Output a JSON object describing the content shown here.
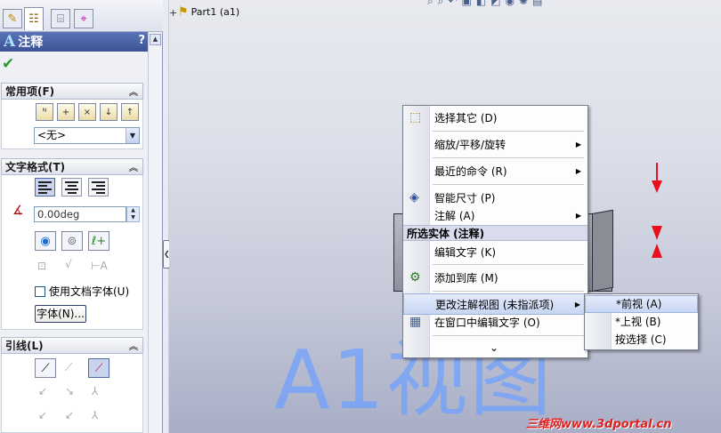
{
  "property_manager": {
    "title": "注释",
    "help": "?",
    "ok": "✔",
    "sections": {
      "common": {
        "label": "常用项(F)",
        "dropdown_value": "<无>"
      },
      "text_format": {
        "label": "文字格式(T)",
        "angle_value": "0.00deg",
        "use_doc_font_label": "使用文档字体(U)",
        "use_doc_font_checked": false,
        "font_button_label": "字体(N)..."
      },
      "leader": {
        "label": "引线(L)"
      }
    },
    "tabs": [
      "feature-manager",
      "property-manager",
      "configuration-manager",
      "dimxpert-manager"
    ]
  },
  "feature_tree": {
    "expand": "+",
    "part_label": "Part1 (a1)"
  },
  "graphics": {
    "big_text": "A1视图",
    "watermark": "三维网www.3dportal.cn"
  },
  "context_menu": {
    "items": [
      {
        "label": "选择其它 (D)",
        "submenu": false
      },
      {
        "label": "缩放/平移/旋转",
        "submenu": true
      },
      {
        "label": "最近的命令 (R)",
        "submenu": true
      },
      {
        "label": "智能尺寸 (P)",
        "submenu": false
      },
      {
        "label": "注解 (A)",
        "submenu": true
      }
    ],
    "section_header": "所选实体 (注释)",
    "section_items": [
      {
        "label": "编辑文字 (K)"
      },
      {
        "label": "添加到库 (M)"
      },
      {
        "label": "更改注解视图 (未指派项)",
        "submenu": true
      },
      {
        "label": "在窗口中编辑文字 (O)"
      }
    ],
    "more": "⌄"
  },
  "submenu": {
    "items": [
      "*前视 (A)",
      "*上视 (B)",
      "按选择 (C)"
    ]
  },
  "colors": {
    "accent_red": "#e8101c",
    "title_blue": "#6aa0ff"
  }
}
